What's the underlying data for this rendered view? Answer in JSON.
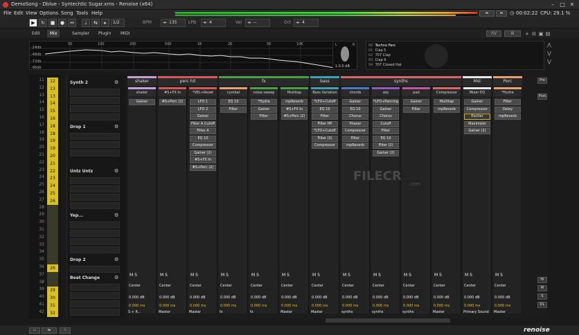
{
  "window": {
    "title": "DemoSong - Dblue - Syntechtic Sugar.xrns - Renoise (x64)"
  },
  "menu": [
    "File",
    "Edit",
    "View",
    "Options",
    "Song",
    "Tools",
    "Help"
  ],
  "status": {
    "time": "00:02:22",
    "cpu": "CPU: 29.1 %"
  },
  "transport": {
    "bpm_label": "BPM",
    "bpm": "135",
    "lpb_label": "LPB",
    "lpb": "4",
    "vel_label": "Vel",
    "vel": "--",
    "oct_label": "Oct",
    "oct": "4",
    "step": "1/2"
  },
  "tabs": [
    "Edit",
    "Mix",
    "Sampler",
    "Plugin",
    "MIDI"
  ],
  "spectrum": {
    "db_labels": [
      "-24db",
      "-48db",
      "-72db",
      "-96db"
    ],
    "freq_labels": [
      "50",
      "100",
      "200",
      "500",
      "1K",
      "2K",
      "5K",
      "10K"
    ],
    "stereo": {
      "l": "L",
      "r": "R",
      "value": "1.0.0 dB"
    }
  },
  "instruments": [
    {
      "num": "00",
      "name": "Techno Perc"
    },
    {
      "num": "01",
      "name": "Clap 5"
    },
    {
      "num": "02",
      "name": "707 Clap"
    },
    {
      "num": "03",
      "name": "Clap 9"
    },
    {
      "num": "04",
      "name": "707 Closed Hat"
    }
  ],
  "patterns": [
    {
      "num": "11",
      "pat": "12",
      "style": "y"
    },
    {
      "num": "12",
      "pat": "13",
      "style": "y"
    },
    {
      "num": "13",
      "pat": "13",
      "style": "y"
    },
    {
      "num": "14",
      "pat": "14",
      "style": "y"
    },
    {
      "num": "15",
      "pat": "15",
      "style": "y"
    },
    {
      "num": "16",
      "pat": "16",
      "style": "y"
    },
    {
      "num": "17",
      "pat": "18",
      "style": "y"
    },
    {
      "num": "18",
      "pat": "18",
      "style": "y"
    },
    {
      "num": "19",
      "pat": "19",
      "style": "y"
    },
    {
      "num": "20",
      "pat": "19",
      "style": "y"
    },
    {
      "num": "21",
      "pat": "20",
      "style": "y"
    },
    {
      "num": "22",
      "pat": "21",
      "style": "y"
    },
    {
      "num": "23",
      "pat": "22",
      "style": "y"
    },
    {
      "num": "24",
      "pat": "23",
      "style": "y"
    },
    {
      "num": "25",
      "pat": "24",
      "style": "y"
    },
    {
      "num": "26",
      "pat": "25",
      "style": "y"
    },
    {
      "num": "27",
      "pat": "26",
      "style": "y"
    },
    {
      "num": "28",
      "pat": "",
      "style": "dim"
    },
    {
      "num": "29",
      "pat": "",
      "style": "dim"
    },
    {
      "num": "30",
      "pat": "",
      "style": "dim"
    },
    {
      "num": "31",
      "pat": "",
      "style": "dim"
    },
    {
      "num": "32",
      "pat": "",
      "style": "dim"
    },
    {
      "num": "33",
      "pat": "",
      "style": "dim"
    },
    {
      "num": "34",
      "pat": "",
      "style": "dim"
    },
    {
      "num": "35",
      "pat": "",
      "style": "dim"
    },
    {
      "num": "36",
      "pat": "26",
      "style": "y"
    },
    {
      "num": "37",
      "pat": "",
      "style": "dim"
    },
    {
      "num": "38",
      "pat": "",
      "style": "dim"
    },
    {
      "num": "39",
      "pat": "29",
      "style": "y"
    },
    {
      "num": "40",
      "pat": "30",
      "style": "y"
    },
    {
      "num": "41",
      "pat": "31",
      "style": "y"
    },
    {
      "num": "42",
      "pat": "32",
      "style": "y"
    }
  ],
  "sections": [
    {
      "title": "Synth 2"
    },
    {
      "title": "Drop 1"
    },
    {
      "title": "Untz Untz"
    },
    {
      "title": "Yep..."
    },
    {
      "title": "Drop 2"
    },
    {
      "title": "Beat Change"
    }
  ],
  "groups": [
    {
      "name": "shaker",
      "color": "#c8a0d8"
    },
    {
      "name": "perc hit",
      "color": "#d85858"
    },
    {
      "name": "fx",
      "color": "#48a048"
    },
    {
      "name": "bass",
      "color": "#40a0b8"
    },
    {
      "name": "synths",
      "color": "#d86868"
    },
    {
      "name": "Mst",
      "color": "#e8e8e8"
    },
    {
      "name": "Perc",
      "color": "#e8a070"
    }
  ],
  "tracks": [
    {
      "name": "shaker",
      "color": "#c8a0d8",
      "devices": [
        "Gainer"
      ],
      "pan": "Center",
      "vol": "0.000 dB",
      "db": "0.000 ms",
      "out": "S + R..."
    },
    {
      "name": "#S+FX In",
      "color": "#d85858",
      "devices": [
        "#S+Perc (2)"
      ],
      "pan": "Center",
      "vol": "0.000 dB",
      "db": "0.000 ms",
      "out": "Master"
    },
    {
      "name": "*VEL+Reset",
      "color": "#d85858",
      "devices": [
        "LFO 1",
        "LFO 2",
        "Gainer",
        "Filter A Cutoff",
        "Filter A",
        "EQ 10",
        "Compressor",
        "Gainer (2)",
        "#S+FX In",
        "#S+Perc (2)"
      ],
      "pan": "Center",
      "vol": "0.000 dB",
      "db": "0.000 ms",
      "out": "Master"
    },
    {
      "name": "cymbal",
      "color": "#e8a070",
      "devices": [
        "EQ 10",
        "Filter"
      ],
      "pan": "Center",
      "vol": "0.000 dB",
      "db": "0.000 ms",
      "out": "fx"
    },
    {
      "name": "noise sweep",
      "color": "#48a048",
      "devices": [
        "*Hydra",
        "Gainer",
        "Filter"
      ],
      "pan": "Center",
      "vol": "0.000 dB",
      "db": "0.000 ms",
      "out": "fx"
    },
    {
      "name": "Multitap",
      "color": "#48a048",
      "devices": [
        "mpReverb",
        "#S+FX In",
        "#S+Perc (2)"
      ],
      "pan": "Center",
      "vol": "0.000 dB",
      "db": "0.000 ms",
      "out": "Master"
    },
    {
      "name": "Bass Variation",
      "color": "#40a0b8",
      "devices": [
        "*LFO+Cutoff",
        "EQ 10",
        "Filter",
        "Filter HP",
        "*LFO+Cutoff",
        "Filter (3)",
        "Compressor"
      ],
      "pan": "Center",
      "vol": "0.000 dB",
      "db": "0.000 ms",
      "out": "Master"
    },
    {
      "name": "chords",
      "color": "#4878c8",
      "devices": [
        "Gainer",
        "EQ 10",
        "Chorus",
        "Phaser",
        "Compressor",
        "Filter",
        "mpReverb"
      ],
      "pan": "Center",
      "vol": "0.000 dB",
      "db": "0.000 ms",
      "out": "synths"
    },
    {
      "name": "arp",
      "color": "#9058c0",
      "devices": [
        "*LFO+Panning",
        "Gainer",
        "Chorus",
        "Cutoff",
        "Filter",
        "EQ 10",
        "Filter (2)",
        "Gainer (2)"
      ],
      "pan": "Center",
      "vol": "0.000 dB",
      "db": "0.000 ms",
      "out": "synths"
    },
    {
      "name": "pad",
      "color": "#c058a8",
      "devices": [
        "Gainer",
        "Filter"
      ],
      "pan": "Center",
      "vol": "0.000 dB",
      "db": "0.000 ms",
      "out": "synths"
    },
    {
      "name": "Compressor",
      "color": "#d86868",
      "devices": [
        "Multitap",
        "mpReverb"
      ],
      "pan": "Center",
      "vol": "0.000 dB",
      "db": "0.000 ms",
      "out": "Master"
    },
    {
      "name": "Mixer EQ",
      "color": "#e8e8e8",
      "devices": [
        "Gainer",
        "Compressor",
        "Exciter",
        "Maximizer",
        "Gainer (2)"
      ],
      "pan": "Center",
      "vol": "0.000 dB",
      "db": "0.000 ms",
      "out": "Primary Sound"
    },
    {
      "name": "*Hydra",
      "color": "#e8a070",
      "devices": [
        "Filter",
        "Delay",
        "mpReverb"
      ],
      "pan": "Center",
      "vol": "0.000 dB",
      "db": "0.000 ms",
      "out": "Master"
    }
  ],
  "side_buttons": [
    "Pre",
    "Post",
    "Hi",
    "M",
    "S",
    "DL"
  ],
  "bottom": {
    "brand": "renoise"
  },
  "watermark": {
    "text": "FILECR",
    "sub": ".com"
  },
  "colors": {
    "accent": "#d8c020",
    "background": "#1a1a1a",
    "panel": "#232323"
  }
}
